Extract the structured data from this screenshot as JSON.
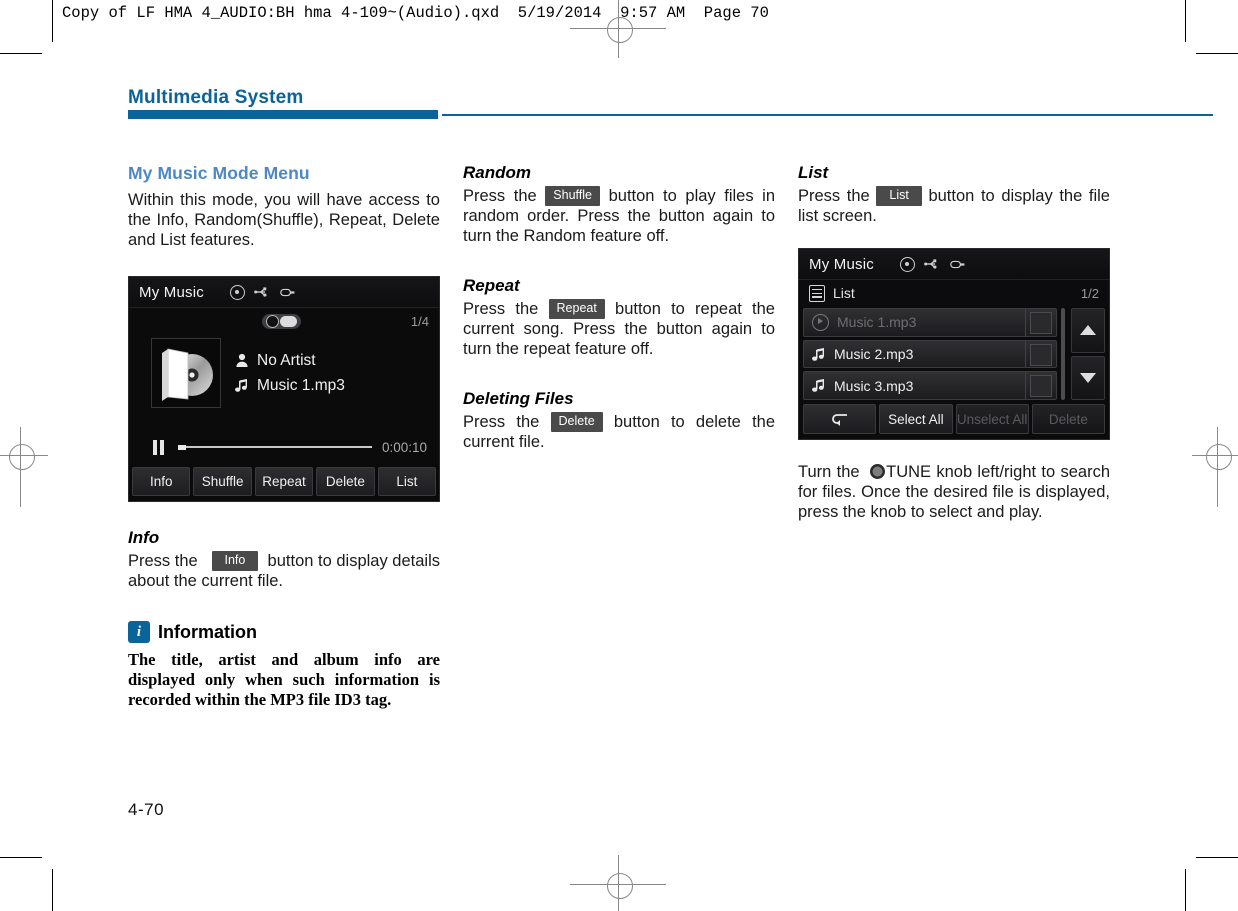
{
  "print_header": "Copy of LF HMA 4_AUDIO:BH hma 4-109~(Audio).qxd  5/19/2014  9:57 AM  Page 70",
  "section": {
    "title": "Multimedia System",
    "accent_color": "#0a6499"
  },
  "folio": "4-70",
  "column_1": {
    "heading": "My Music Mode Menu",
    "heading_color": "#4d88c4",
    "intro": "Within this mode, you will have access to the Info, Random(Shuffle), Repeat, Delete and List features.",
    "player_screen": {
      "title": "My Music",
      "icons": [
        "disc-icon",
        "usb-icon",
        "aux-icon"
      ],
      "repeat_badge": "repeat-indicator",
      "page_indicator": "1/4",
      "artist": "No Artist",
      "track": "Music 1.mp3",
      "transport_state": "paused",
      "elapsed_time": "0:00:10",
      "buttons": [
        "Info",
        "Shuffle",
        "Repeat",
        "Delete",
        "List"
      ]
    },
    "info_section": {
      "heading": "Info",
      "text_before": "Press the",
      "chip": "Info",
      "text_after": "button to display details about the current file."
    },
    "note": {
      "title": "Information",
      "badge": "i",
      "body": "The title, artist and album info are displayed only when such information is recorded within the MP3 file ID3 tag."
    }
  },
  "column_2": {
    "random": {
      "heading": "Random",
      "text_before": "Press the",
      "chip": "Shuffle",
      "text_after": "button to play files in random order. Press the button again to turn the Random feature off."
    },
    "repeat": {
      "heading": "Repeat",
      "text_before": "Press the",
      "chip": "Repeat",
      "text_after": "button to repeat the current song. Press the button again to turn the repeat feature off."
    },
    "deleting": {
      "heading": "Deleting Files",
      "text_before": "Press the",
      "chip": "Delete",
      "text_after": "button to delete the current file."
    }
  },
  "column_3": {
    "list": {
      "heading": "List",
      "text_before": "Press the",
      "chip": "List",
      "text_after": "button to display the file list screen."
    },
    "list_screen": {
      "title": "My Music",
      "icons": [
        "disc-icon",
        "usb-icon",
        "aux-icon"
      ],
      "list_label": "List",
      "page_indicator": "1/2",
      "rows": [
        {
          "name": "Music 1.mp3",
          "icon": "play-circle-icon",
          "state": "playing"
        },
        {
          "name": "Music 2.mp3",
          "icon": "music-note-icon",
          "state": "normal"
        },
        {
          "name": "Music 3.mp3",
          "icon": "music-note-icon",
          "state": "normal"
        }
      ],
      "footer_buttons": [
        {
          "label": "",
          "icon": "back-arrow-icon",
          "disabled": false
        },
        {
          "label": "Select All",
          "disabled": false
        },
        {
          "label": "Unselect All",
          "disabled": true
        },
        {
          "label": "Delete",
          "disabled": true
        }
      ]
    },
    "tune_text_before": "Turn the",
    "tune_knob_label": "TUNE",
    "tune_text_after": "knob left/right to search for files. Once the desired file is displayed, press the knob to select and play."
  }
}
